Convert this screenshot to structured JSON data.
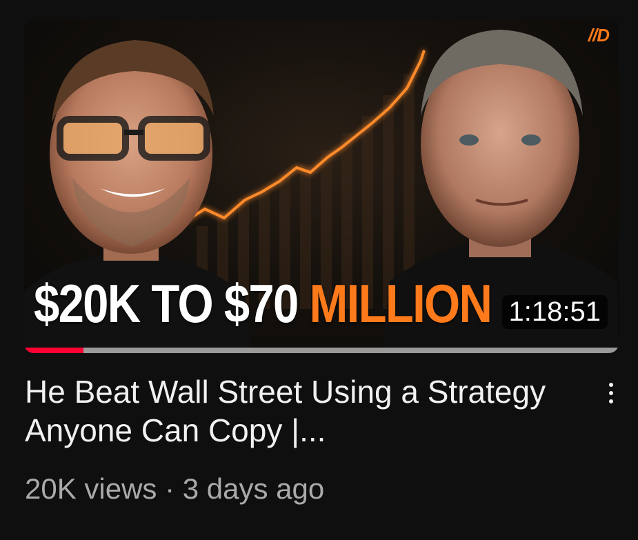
{
  "video": {
    "thumbnail": {
      "headline_white": "$20K TO $70 ",
      "headline_orange": "MILLION",
      "logo": "//D",
      "duration": "1:18:51",
      "watch_progress": 0.1
    },
    "title": "He Beat Wall Street Using a Strategy Anyone Can Copy |...",
    "views": "20K views",
    "separator": "·",
    "age": "3 days ago",
    "menu_icon": "more-vertical-icon"
  },
  "colors": {
    "background": "#0f0f0f",
    "accent_orange": "#ff7a1a",
    "progress_red": "#ff0033",
    "title_text": "#f1f1f1",
    "meta_text": "#aaaaaa"
  }
}
